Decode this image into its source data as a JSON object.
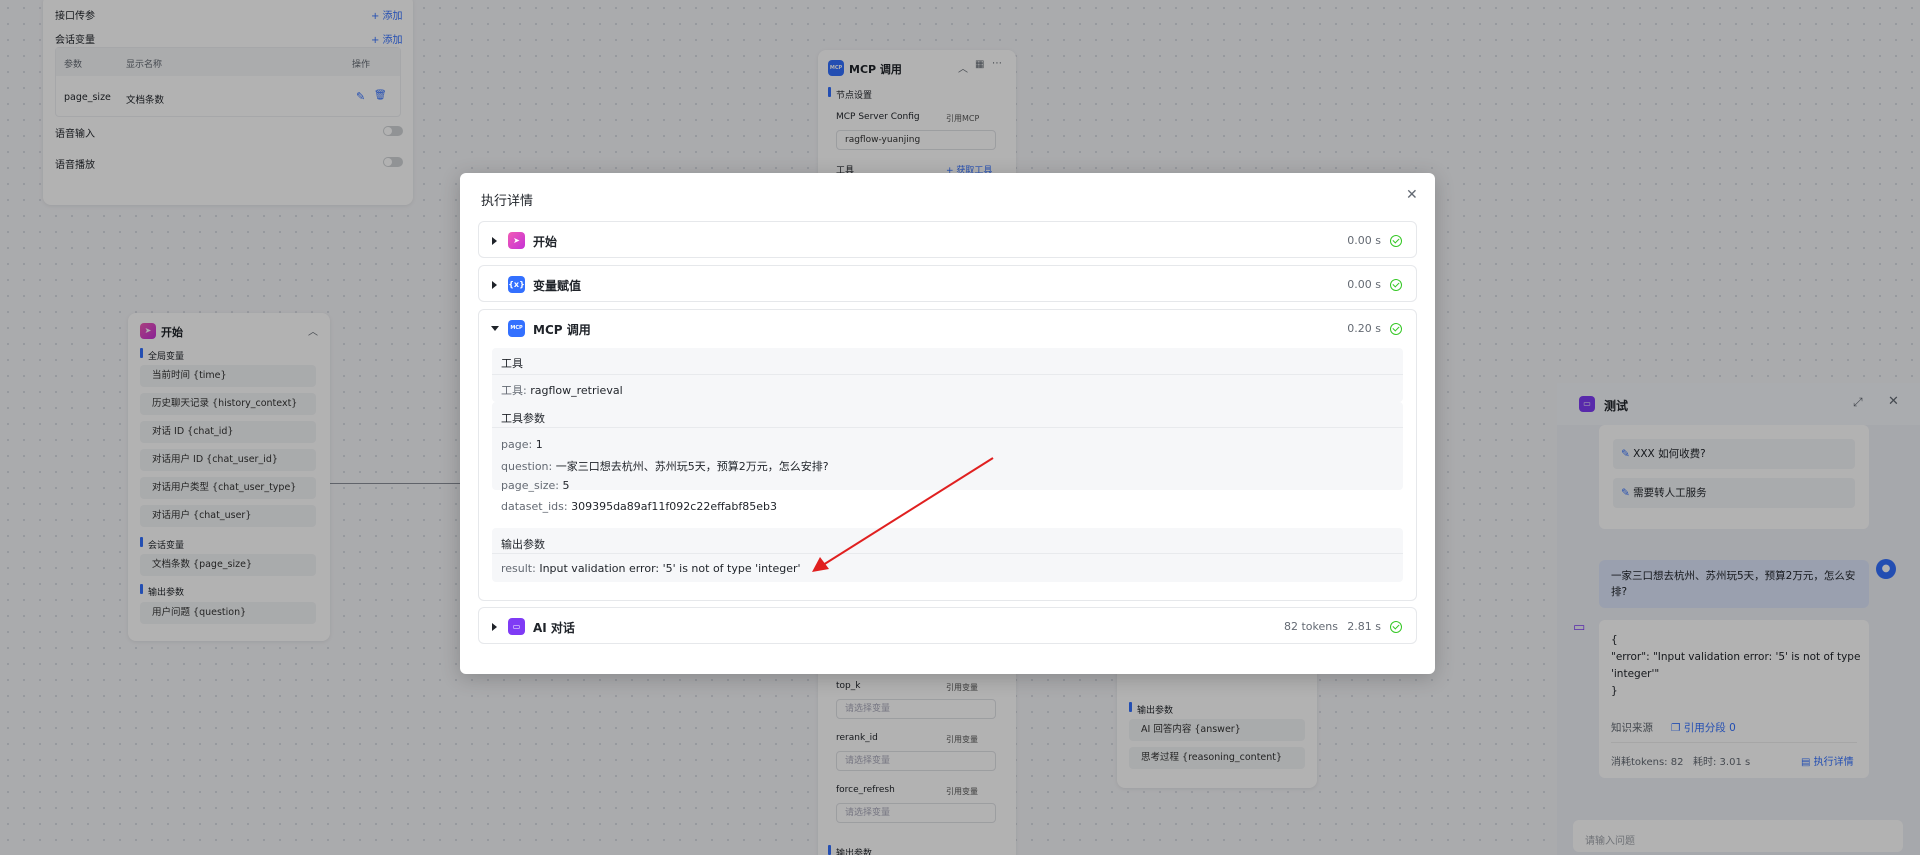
{
  "left_panel": {
    "interface_params_label": "接口传参",
    "session_var_label": "会话变量",
    "add_label": "+ 添加",
    "table_headers": [
      "参数",
      "显示名称",
      "操作"
    ],
    "row": {
      "param": "page_size",
      "display": "文档条数"
    },
    "voice_input": "语音输入",
    "voice_play": "语音播放"
  },
  "start_node": {
    "title": "开始",
    "global_vars_label": "全局变量",
    "global_vars": [
      "当前时间 {time}",
      "历史聊天记录 {history_context}",
      "对话 ID {chat_id}",
      "对话用户 ID {chat_user_id}",
      "对话用户类型 {chat_user_type}",
      "对话用户 {chat_user}"
    ],
    "session_vars_label": "会话变量",
    "session_vars": [
      "文档条数 {page_size}"
    ],
    "output_label": "输出参数",
    "outputs": [
      "用户问题 {question}"
    ]
  },
  "mcp_node": {
    "title": "MCP 调用",
    "icon": "MCP",
    "settings_label": "节点设置",
    "server_config_label": "MCP Server Config",
    "ref_mcp": "引用MCP",
    "server_value": "ragflow-yuanjing",
    "tools_label": "工具",
    "fetch_tools": "+ 获取工具",
    "params": [
      {
        "name": "top_k",
        "ref": "引用变量",
        "placeholder": "请选择变量"
      },
      {
        "name": "rerank_id",
        "ref": "引用变量",
        "placeholder": "请选择变量"
      },
      {
        "name": "force_refresh",
        "ref": "引用变量",
        "placeholder": "请选择变量"
      }
    ],
    "output_label": "输出参数"
  },
  "ai_node": {
    "output_label": "输出参数",
    "outputs": [
      "AI 回答内容 {answer}",
      "思考过程 {reasoning_content}"
    ]
  },
  "chat_panel": {
    "title": "测试",
    "suggestions": [
      "XXX 如何收费?",
      "需要转人工服务"
    ],
    "user_message": "一家三口想去杭州、苏州玩5天，预算2万元，怎么安排?",
    "bot_message": [
      "{",
      "\"error\": \"Input validation error: '5' is not of type",
      "'integer'\"",
      "}"
    ],
    "knowledge_label": "知识来源",
    "cite_label": "引用分段 0",
    "tokens_text": "消耗tokens: 82",
    "time_text": "耗时: 3.01 s",
    "exec_detail": "执行详情",
    "input_placeholder": "请输入问题"
  },
  "modal": {
    "title": "执行详情",
    "sections": [
      {
        "title": "开始",
        "icon": "start-icon",
        "time": "0.00 s",
        "status": "success"
      },
      {
        "title": "变量赋值",
        "icon": "variable-icon",
        "time": "0.00 s",
        "status": "success"
      },
      {
        "title": "MCP 调用",
        "icon": "mcp-icon",
        "time": "0.20 s",
        "status": "success",
        "tool_group": {
          "title": "工具",
          "tool_key": "工具:",
          "tool_value": "ragflow_retrieval"
        },
        "params_group": {
          "title": "工具参数",
          "items": [
            {
              "key": "page:",
              "value": "1"
            },
            {
              "key": "question:",
              "value": "一家三口想去杭州、苏州玩5天，预算2万元，怎么安排?"
            },
            {
              "key": "page_size:",
              "value": "5"
            },
            {
              "key": "dataset_ids:",
              "value": "309395da89af11f092c22effabf85eb3"
            }
          ]
        },
        "output_group": {
          "title": "输出参数",
          "result_key": "result:",
          "result_value": "Input validation error: '5' is not of type 'integer'"
        }
      },
      {
        "title": "AI 对话",
        "icon": "ai-chat-icon",
        "tokens": "82 tokens",
        "time": "2.81 s",
        "status": "success"
      }
    ]
  },
  "colors": {
    "accent": "#3370ff",
    "success": "#34c724",
    "arrow": "#e02020"
  }
}
